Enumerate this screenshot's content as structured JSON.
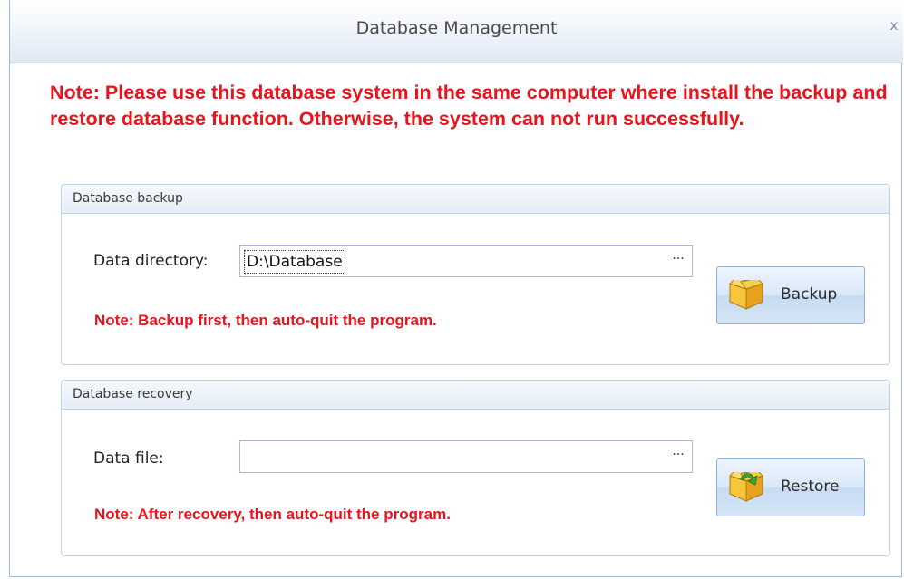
{
  "window": {
    "title": "Database Management",
    "close_glyph": "x"
  },
  "main_note": "Note: Please use this database system in the same computer where install the backup and restore database function. Otherwise, the system can not run successfully.",
  "backup": {
    "group_title": "Database backup",
    "field_label": "Data directory:",
    "field_value": "D:\\Database",
    "browse_glyph": "···",
    "note": "Note: Backup first, then auto-quit the program.",
    "button_label": "Backup",
    "button_icon": "box-icon"
  },
  "recovery": {
    "group_title": "Database recovery",
    "field_label": "Data file:",
    "field_value": "",
    "browse_glyph": "···",
    "note": "Note: After recovery, then auto-quit the program.",
    "button_label": "Restore",
    "button_icon": "box-arrow-icon"
  },
  "colors": {
    "note_red": "#e8141c",
    "frame_blue": "#9fb7d8"
  }
}
